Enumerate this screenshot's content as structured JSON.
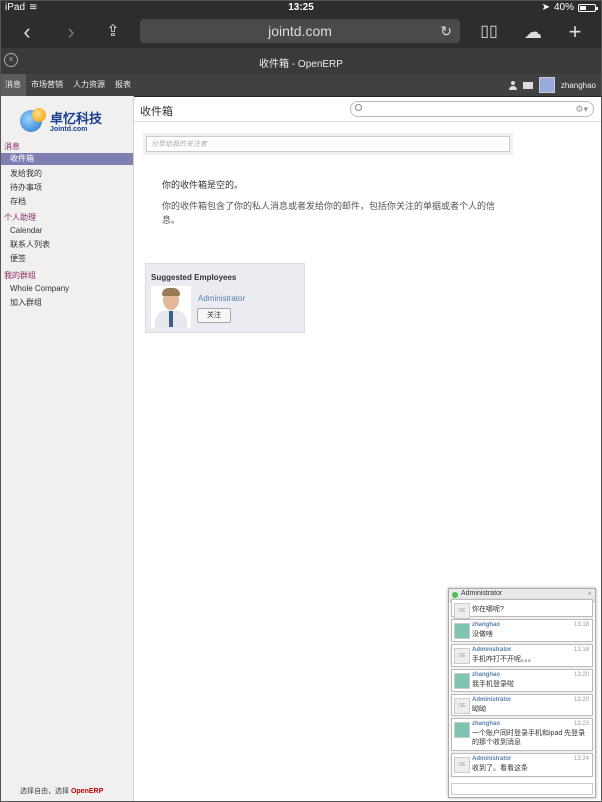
{
  "status_bar": {
    "device": "iPad",
    "time": "13:25",
    "battery": "40%"
  },
  "browser": {
    "url": "jointd.com",
    "tab_title": "收件箱 - OpenERP"
  },
  "top_menu": {
    "items": [
      "消息",
      "市场营销",
      "人力资源",
      "报表"
    ],
    "username": "zhanghao"
  },
  "logo": {
    "name": "卓忆科技",
    "sub": "Jointd.com"
  },
  "sidebar": {
    "sections": [
      {
        "title": "消息",
        "items": [
          "收件箱",
          "发给我的",
          "待办事项",
          "存档"
        ]
      },
      {
        "title": "个人助理",
        "items": [
          "Calendar",
          "联系人列表",
          "便签"
        ]
      },
      {
        "title": "我的群组",
        "items": [
          "Whole Company",
          "加入群组"
        ]
      }
    ],
    "footer_text": "选择自由，选择",
    "footer_brand": "OpenERP"
  },
  "main": {
    "title": "收件箱",
    "share_placeholder": "分享给我的关注者",
    "empty_title": "你的收件箱是空的。",
    "empty_desc": "你的收件箱包含了你的私人消息或者发给你的邮件，包括你关注的单据或者个人的信息。"
  },
  "suggested": {
    "title": "Suggested Employees",
    "employee_name": "Administrator",
    "follow_label": "关注"
  },
  "chat": {
    "partner": "Administrator",
    "messages": [
      {
        "from": "",
        "time": "",
        "text": "你在哪呢?",
        "avatar": "admin"
      },
      {
        "from": "zhanghao",
        "time": "13:18",
        "text": "没做啥",
        "avatar": "user"
      },
      {
        "from": "Administrator",
        "time": "13:18",
        "text": "手机咋打不开呢。。。",
        "avatar": "admin"
      },
      {
        "from": "zhanghao",
        "time": "13:20",
        "text": "我手机登录啦",
        "avatar": "user"
      },
      {
        "from": "Administrator",
        "time": "13:20",
        "text": "呦呦",
        "avatar": "admin"
      },
      {
        "from": "zhanghao",
        "time": "13:23",
        "text": "一个账户同时登录手机和ipad 先登录的那个收到消息",
        "avatar": "user"
      },
      {
        "from": "Administrator",
        "time": "13:24",
        "text": "收到了。看看这条",
        "avatar": "admin"
      }
    ]
  },
  "colors": {
    "accent": "#7f7fb3",
    "section": "#8b2a5a",
    "link": "#5b7fad",
    "brand": "#c00000"
  }
}
